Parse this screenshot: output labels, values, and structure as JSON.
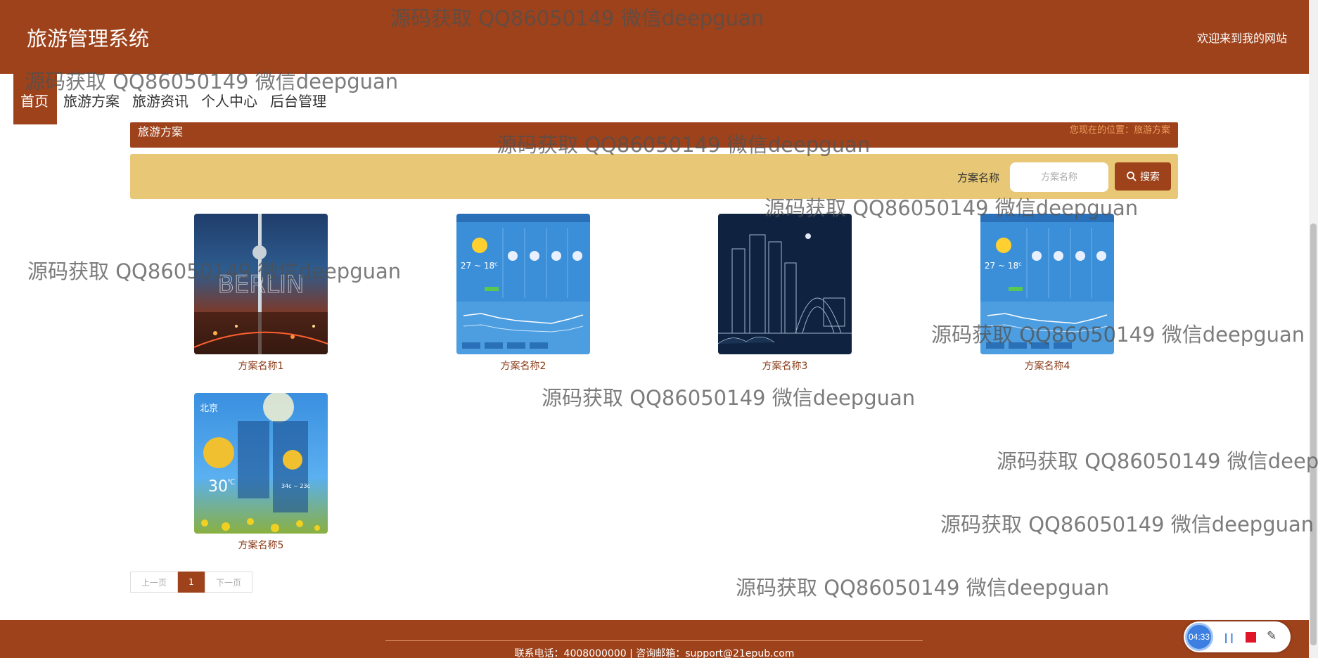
{
  "header": {
    "brand": "旅游管理系统",
    "welcome": "欢迎来到我的网站"
  },
  "nav": {
    "items": [
      "首页",
      "旅游方案",
      "旅游资讯",
      "个人中心",
      "后台管理"
    ]
  },
  "section": {
    "title": "旅游方案",
    "breadcrumb": "您现在的位置：旅游方案"
  },
  "search": {
    "label": "方案名称",
    "placeholder": "方案名称",
    "button": "搜索"
  },
  "plans": [
    {
      "name": "方案名称1"
    },
    {
      "name": "方案名称2"
    },
    {
      "name": "方案名称3"
    },
    {
      "name": "方案名称4"
    },
    {
      "name": "方案名称5"
    }
  ],
  "thumbnails": {
    "city_text": "BERLIN",
    "weather_temp": "27 ~ 18",
    "weather_unit": "℃",
    "beijing_city": "北京",
    "beijing_temp": "30",
    "beijing_unit": "℃",
    "beijing_temp2": "34c ~ 23c"
  },
  "pagination": {
    "prev": "上一页",
    "current": "1",
    "next": "下一页"
  },
  "footer": {
    "text": "联系电话：4008000000 | 咨询邮箱：support@21epub.com"
  },
  "recorder": {
    "time": "04:33",
    "pause": "| |"
  },
  "watermark": "源码获取 QQ86050149 微信deepguan"
}
